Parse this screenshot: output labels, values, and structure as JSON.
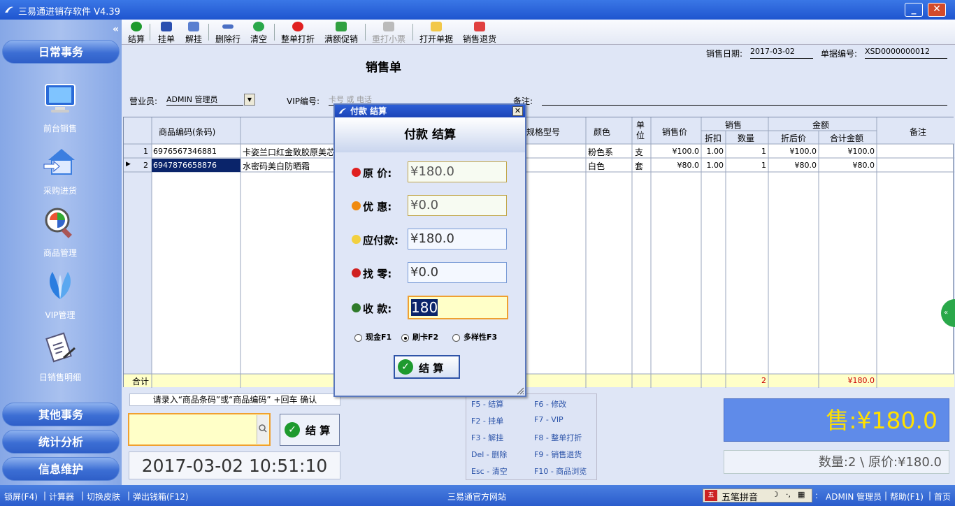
{
  "window": {
    "title": "三易通进销存软件 V4.39"
  },
  "sidebar": {
    "sections": {
      "daily": "日常事务",
      "other": "其他事务",
      "stats": "统计分析",
      "info": "信息维护"
    },
    "items": [
      {
        "label": "前台销售",
        "icon": "monitor-icon"
      },
      {
        "label": "采购进货",
        "icon": "house-arrow-icon"
      },
      {
        "label": "商品管理",
        "icon": "magnifier-icon"
      },
      {
        "label": "VIP管理",
        "icon": "vip-icon"
      },
      {
        "label": "日销售明细",
        "icon": "report-icon"
      }
    ]
  },
  "toolbar": {
    "checkout": "结算",
    "hold": "挂单",
    "unhold": "解挂",
    "delete_row": "删除行",
    "clear": "清空",
    "discount_all": "整单打折",
    "promo": "满额促销",
    "reprint": "重打小票",
    "open_receipt": "打开单据",
    "return": "销售退货"
  },
  "form": {
    "title": "销售单",
    "date_label": "销售日期:",
    "date_value": "2017-03-02",
    "no_label": "单据编号:",
    "no_value": "XSD0000000012",
    "clerk_label": "营业员:",
    "clerk_value": "ADMIN 管理员",
    "vip_label": "VIP编号:",
    "vip_placeholder": "卡号 或 电话",
    "note_label": "备注:"
  },
  "grid": {
    "headers": {
      "code": "商品编码(条码)",
      "spec": "规格型号",
      "color": "颜色",
      "unit": "单位",
      "price": "销售价",
      "sale": "销售",
      "discount": "折扣",
      "qty": "数量",
      "amount": "金额",
      "after": "折后价",
      "total": "合计金额",
      "remark": "备注"
    },
    "rows": [
      {
        "no": "1",
        "code": "6976567346881",
        "name": "卡姿兰口红金致胶原美芯",
        "color": "粉色系",
        "unit": "支",
        "price": "¥100.0",
        "discount": "1.00",
        "qty": "1",
        "after": "¥100.0",
        "total": "¥100.0"
      },
      {
        "no": "2",
        "code": "6947876658876",
        "name": "水密码美白防晒霜",
        "color": "白色",
        "unit": "套",
        "price": "¥80.0",
        "discount": "1.00",
        "qty": "1",
        "after": "¥80.0",
        "total": "¥80.0"
      }
    ],
    "footer": {
      "label": "合计",
      "qty": "2",
      "total": "¥180.0"
    }
  },
  "bottom": {
    "hint": "请录入“商品条码”或“商品编码” +回车 确认",
    "settle_label": "结 算",
    "clock": "2017-03-02 10:51:10",
    "shortcuts": [
      [
        "F5 - 结算",
        "F6 - 修改"
      ],
      [
        "F2 - 挂单",
        "F7 - VIP"
      ],
      [
        "F3 - 解挂",
        "F8 - 整单打折"
      ],
      [
        "Del - 删除",
        "F9 - 销售退货"
      ],
      [
        "Esc - 清空",
        "F10 - 商品浏览"
      ]
    ],
    "big_price": "售:¥180.0",
    "summary": "数量:2 \\ 原价:¥180.0"
  },
  "dialog": {
    "title": "付款 结算",
    "heading": "付款 结算",
    "fields": [
      {
        "label": "原  价:",
        "value": "¥180.0"
      },
      {
        "label": "优  惠:",
        "value": "¥0.0"
      },
      {
        "label": "应付款:",
        "value": "¥180.0"
      },
      {
        "label": "找  零:",
        "value": "¥0.0"
      },
      {
        "label": "收  款:",
        "value": "180"
      }
    ],
    "pay": {
      "cash": "现金F1",
      "card": "刷卡F2",
      "multi": "多样性F3",
      "selected": "card"
    },
    "ok": "结 算"
  },
  "statusbar": {
    "lock": "锁屏(F4)",
    "calc": "计算器",
    "skin": "切换皮肤",
    "drawer": "弹出钱箱(F12)",
    "site": "三易通官方网站",
    "ime": "五笔拼音",
    "user": "ADMIN 管理员",
    "help": "帮助(F1)",
    "home": "首页"
  },
  "colors": {
    "accent": "#2a5ccc",
    "price": "#ffe000",
    "panel": "#5f8be9"
  }
}
